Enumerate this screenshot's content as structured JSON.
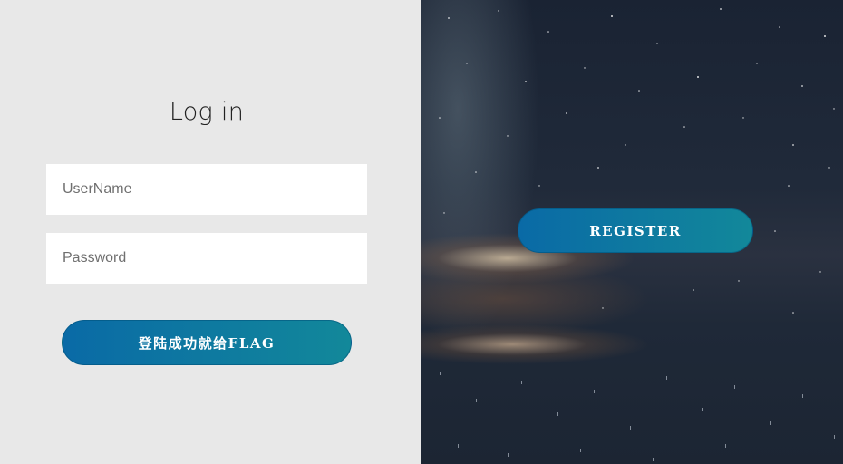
{
  "login": {
    "title": "Log in",
    "username_placeholder": "UserName",
    "password_placeholder": "Password",
    "submit_label": "登陆成功就给FLAG"
  },
  "register": {
    "button_label": "REGISTER"
  },
  "colors": {
    "left_bg": "#e8e8e8",
    "button_gradient_start": "#0a6aa6",
    "button_gradient_end": "#12889a"
  }
}
